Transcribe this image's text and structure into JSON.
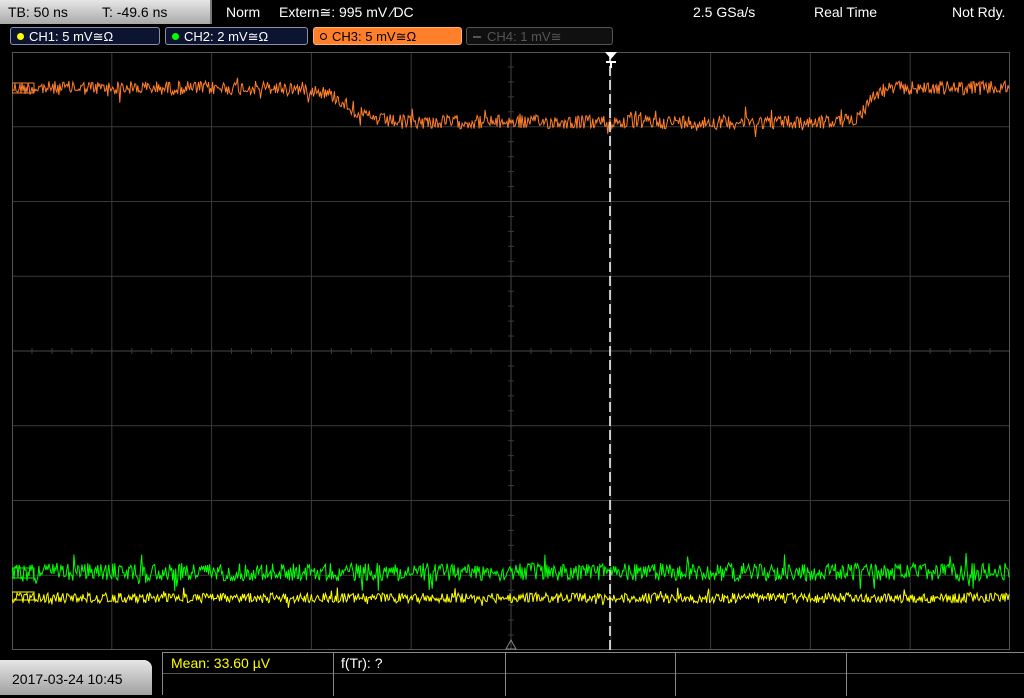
{
  "topbar": {
    "timebase": "TB: 50 ns",
    "trigger_time": "T: -49.6 ns",
    "mode": "Norm",
    "trigger_source": "Extern≅: 995 mV ∕DC",
    "sample_rate": "2.5 GSa/s",
    "acq_mode": "Real Time",
    "state": "Not Rdy."
  },
  "channels": [
    {
      "label": "CH1: 5 mV≅Ω",
      "color": "#ffff00",
      "active": true
    },
    {
      "label": "CH2: 2 mV≅Ω",
      "color": "#00ff00",
      "active": true
    },
    {
      "label": "CH3: 5 mV≅Ω",
      "color": "#ff7f2a",
      "active": true,
      "selected": true
    },
    {
      "label": "CH4: 1 mV≅",
      "color": "#555555",
      "active": false
    }
  ],
  "colors": {
    "ch1": "#ffff00",
    "ch2": "#00ff00",
    "ch3": "#ff7f2a",
    "grid": "#3a3a3a"
  },
  "bottom": {
    "datetime": "2017-03-24 10:45",
    "mean": "Mean: 33.60 µV",
    "f_tr": "f(Tr): ?"
  }
}
